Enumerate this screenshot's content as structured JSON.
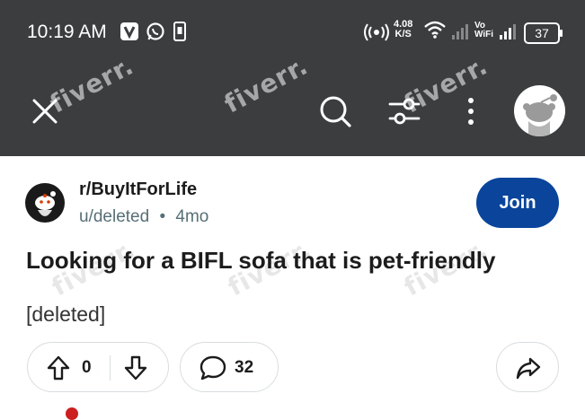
{
  "status_bar": {
    "time": "10:19 AM",
    "net_speed_value": "4.08",
    "net_speed_unit": "K/S",
    "vowifi_top": "Vo",
    "vowifi_bottom": "WiFi",
    "battery": "37"
  },
  "app_bar": {
    "close_icon": "close-icon",
    "search_icon": "search-icon",
    "filter_icon": "filter-icon",
    "more_icon": "more-vertical-icon"
  },
  "post": {
    "subreddit": "r/BuyItForLife",
    "author": "u/deleted",
    "separator": "•",
    "age": "4mo",
    "join_label": "Join",
    "title": "Looking for a BIFL sofa that is pet-friendly",
    "body": "[deleted]",
    "vote_count": "0",
    "comment_count": "32"
  },
  "watermark": "fiverr.",
  "colors": {
    "header_bg": "#3b3d3f",
    "join_bg": "#0a449b",
    "meta_text": "#576f76"
  }
}
